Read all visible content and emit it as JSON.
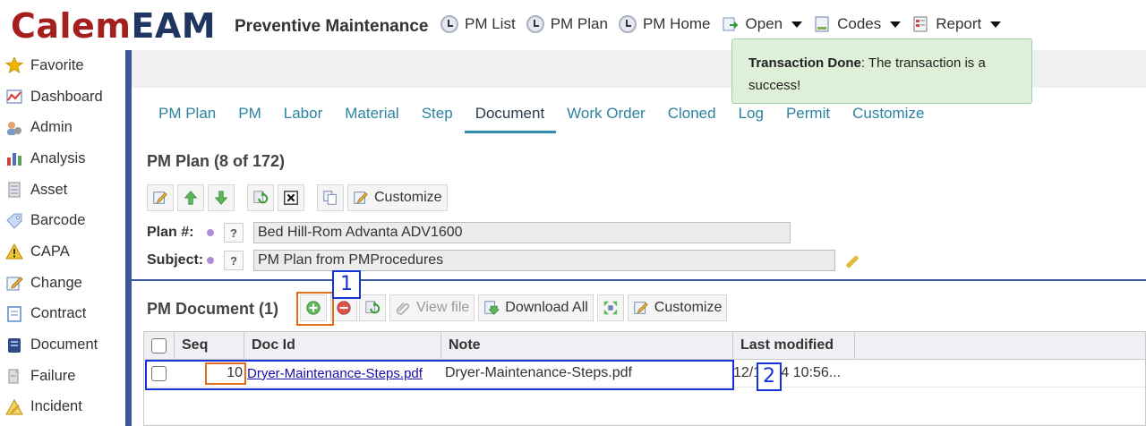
{
  "header": {
    "logo_part1": "Calem",
    "logo_part2": "EAM",
    "module_title": "Preventive Maintenance",
    "menu": [
      {
        "label": "PM List",
        "icon": "clock-icon"
      },
      {
        "label": "PM Plan",
        "icon": "clock-icon"
      },
      {
        "label": "PM Home",
        "icon": "clock-icon"
      },
      {
        "label": "Open",
        "icon": "open-icon"
      },
      {
        "label": "Codes",
        "icon": "document-icon"
      },
      {
        "label": "Report",
        "icon": "report-icon"
      }
    ]
  },
  "sidebar": {
    "items": [
      {
        "label": "Favorite",
        "icon": "star-icon",
        "color": "#f0b400"
      },
      {
        "label": "Dashboard",
        "icon": "dashboard-icon",
        "color": "#4f6fb8"
      },
      {
        "label": "Admin",
        "icon": "admin-icon",
        "color": "#7a9ac9"
      },
      {
        "label": "Analysis",
        "icon": "chart-icon",
        "color": "#c94242"
      },
      {
        "label": "Asset",
        "icon": "asset-icon",
        "color": "#8a8f9a"
      },
      {
        "label": "Barcode",
        "icon": "tag-icon",
        "color": "#a9c3e6"
      },
      {
        "label": "CAPA",
        "icon": "warning-icon",
        "color": "#f2c230"
      },
      {
        "label": "Change",
        "icon": "edit-icon",
        "color": "#e9b54a"
      },
      {
        "label": "Contract",
        "icon": "contract-icon",
        "color": "#5e86c4"
      },
      {
        "label": "Document",
        "icon": "document-icon",
        "color": "#2e4a86"
      },
      {
        "label": "Failure",
        "icon": "failure-icon",
        "color": "#8f8f8f"
      },
      {
        "label": "Incident",
        "icon": "incident-icon",
        "color": "#d9a72e"
      }
    ]
  },
  "toast": {
    "title": "Transaction Done",
    "message": ": The transaction is a success!"
  },
  "tabs": [
    {
      "label": "PM Plan",
      "active": false
    },
    {
      "label": "PM",
      "active": false
    },
    {
      "label": "Labor",
      "active": false
    },
    {
      "label": "Material",
      "active": false
    },
    {
      "label": "Step",
      "active": false
    },
    {
      "label": "Document",
      "active": true
    },
    {
      "label": "Work Order",
      "active": false
    },
    {
      "label": "Cloned",
      "active": false
    },
    {
      "label": "Log",
      "active": false
    },
    {
      "label": "Permit",
      "active": false
    },
    {
      "label": "Customize",
      "active": false
    }
  ],
  "form": {
    "title": "PM Plan (8 of 172)",
    "toolbar": {
      "customize_label": "Customize"
    },
    "fields": [
      {
        "label": "Plan #:",
        "value": "Bed Hill-Rom Advanta ADV1600"
      },
      {
        "label": "Subject:",
        "value": "PM Plan from PMProcedures"
      }
    ],
    "help_label": "?"
  },
  "documents": {
    "title": "PM Document (1)",
    "toolbar": {
      "view_file_label": "View file",
      "download_all_label": "Download All",
      "customize_label": "Customize"
    },
    "columns": [
      "Seq",
      "Doc Id",
      "Note",
      "Last modified"
    ],
    "rows": [
      {
        "seq": "10",
        "doc_id": "Dryer-Maintenance-Steps.pdf",
        "note": "Dryer-Maintenance-Steps.pdf",
        "last_modified": "12/16/24 10:56..."
      }
    ]
  },
  "annotations": {
    "label1": "1",
    "label2": "2"
  },
  "colors": {
    "accent": "#2b83a0",
    "brand_red": "#a3201f",
    "brand_navy": "#1f3663",
    "success_bg": "#dff0d8",
    "highlight_orange": "#e36f1e",
    "highlight_blue": "#1432d8"
  }
}
